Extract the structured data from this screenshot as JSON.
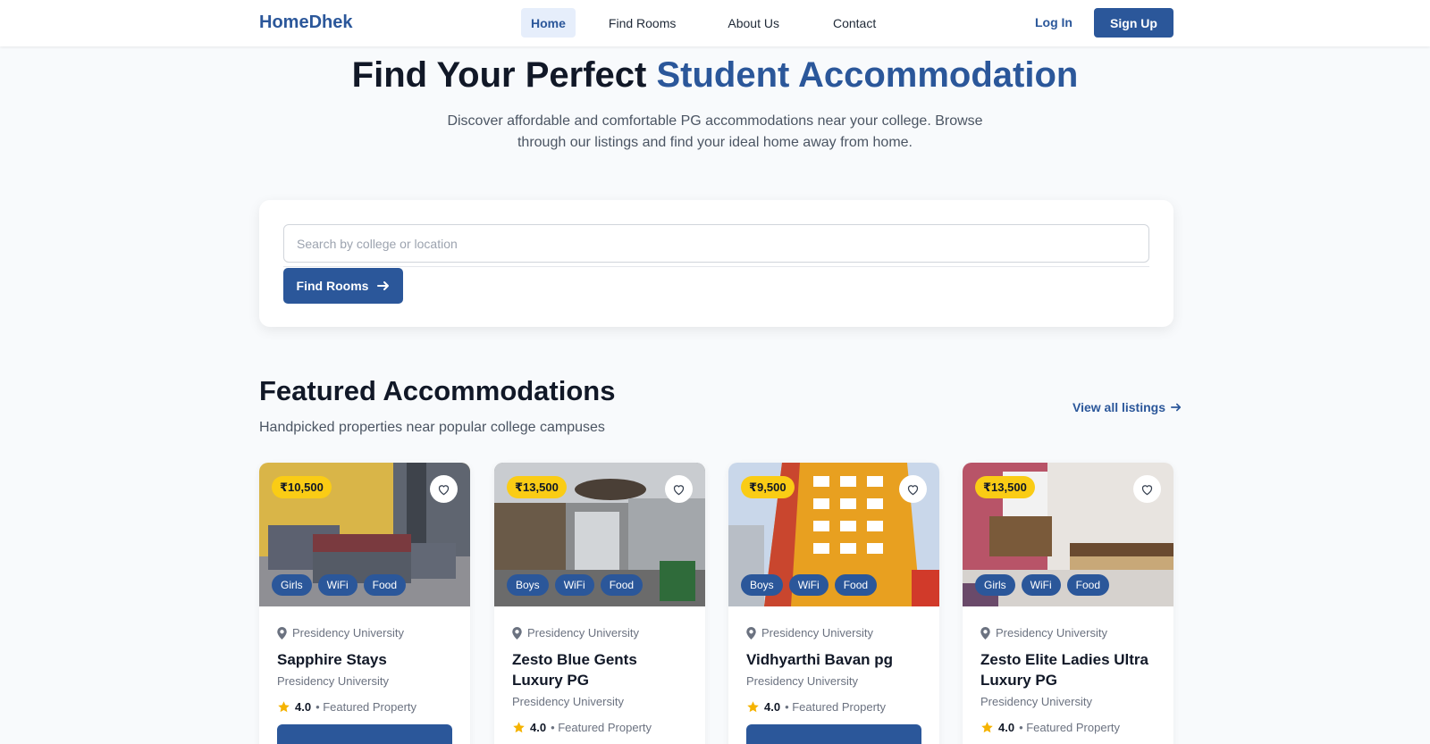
{
  "header": {
    "logo": "HomeDhek",
    "nav": [
      "Home",
      "Find Rooms",
      "About Us",
      "Contact"
    ],
    "active_nav": "Home",
    "login": "Log In",
    "signup": "Sign Up"
  },
  "hero": {
    "title_part1": "Find Your Perfect ",
    "title_part2": "Student Accommodation",
    "subtitle": "Discover affordable and comfortable PG accommodations near your college. Browse through our listings and find your ideal home away from home."
  },
  "search": {
    "placeholder": "Search by college or location",
    "value": "",
    "button": "Find Rooms"
  },
  "featured": {
    "title": "Featured Accommodations",
    "subtitle": "Handpicked properties near popular college campuses",
    "view_all": "View all listings"
  },
  "cards": [
    {
      "price": "₹10,500",
      "tags": [
        "Girls",
        "WiFi",
        "Food"
      ],
      "location": "Presidency University",
      "name": "Sapphire Stays",
      "university": "Presidency University",
      "rating": "4.0",
      "rating_note": "• Featured Property"
    },
    {
      "price": "₹13,500",
      "tags": [
        "Boys",
        "WiFi",
        "Food"
      ],
      "location": "Presidency University",
      "name": "Zesto Blue Gents Luxury PG",
      "university": "Presidency University",
      "rating": "4.0",
      "rating_note": "• Featured Property"
    },
    {
      "price": "₹9,500",
      "tags": [
        "Boys",
        "WiFi",
        "Food"
      ],
      "location": "Presidency University",
      "name": "Vidhyarthi Bavan pg",
      "university": "Presidency University",
      "rating": "4.0",
      "rating_note": "• Featured Property"
    },
    {
      "price": "₹13,500",
      "tags": [
        "Girls",
        "WiFi",
        "Food"
      ],
      "location": "Presidency University",
      "name": "Zesto Elite Ladies Ultra Luxury PG",
      "university": "Presidency University",
      "rating": "4.0",
      "rating_note": "• Featured Property"
    }
  ],
  "colors": {
    "primary": "#2b579a",
    "price_badge": "#facc15",
    "star": "#f5b301"
  },
  "icons": [
    "map-pin-icon",
    "heart-icon",
    "star-icon",
    "arrow-right-icon"
  ]
}
